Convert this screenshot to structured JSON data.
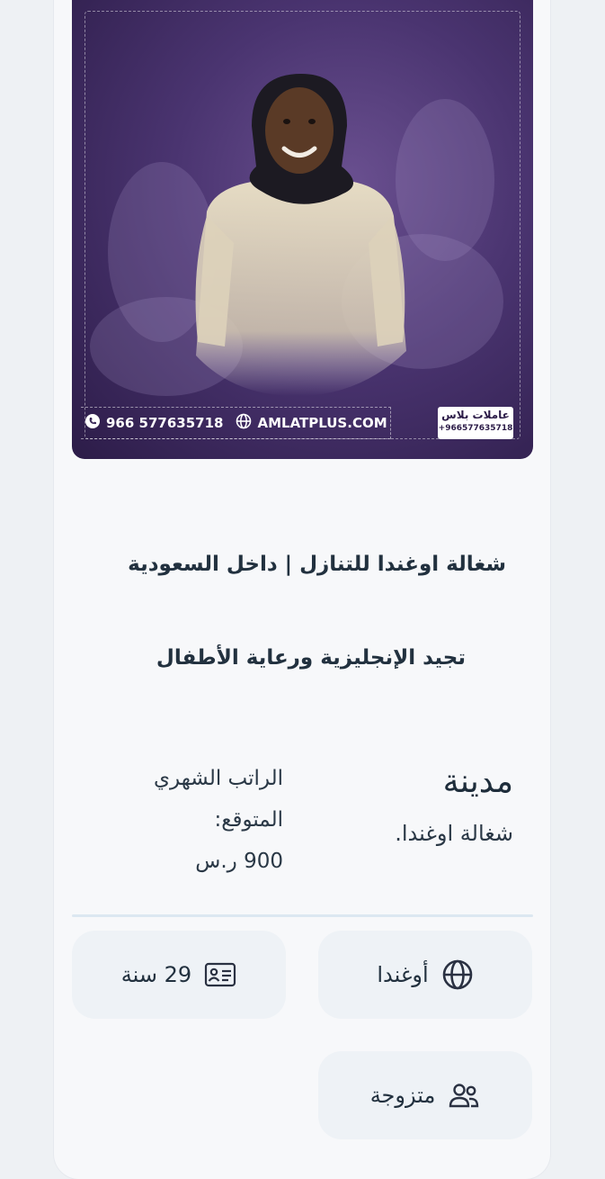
{
  "photo": {
    "phone": "966 577635718",
    "website": "AMLATPLUS.COM",
    "logo_name": "عاملات بلاس",
    "logo_phone": "+966577635718"
  },
  "listing": {
    "title_line1": "شغالة اوغندا للتنازل | داخل السعودية",
    "title_line2": "تجيد الإنجليزية ورعاية الأطفال",
    "city_label": "مدينة",
    "city_value": "شغالة اوغندا.",
    "salary_label_line1": "الراتب الشهري",
    "salary_label_line2": "المتوقع:",
    "salary_value": "900 ر.س",
    "nationality": "أوغندا",
    "age": "29 سنة",
    "marital_status": "متزوجة"
  },
  "colors": {
    "photo_bg": "#4a3470",
    "chip_bg": "#eef2f6",
    "text": "#22313f"
  },
  "icons": [
    "phone-icon",
    "globe-icon",
    "id-card-icon",
    "users-icon"
  ]
}
